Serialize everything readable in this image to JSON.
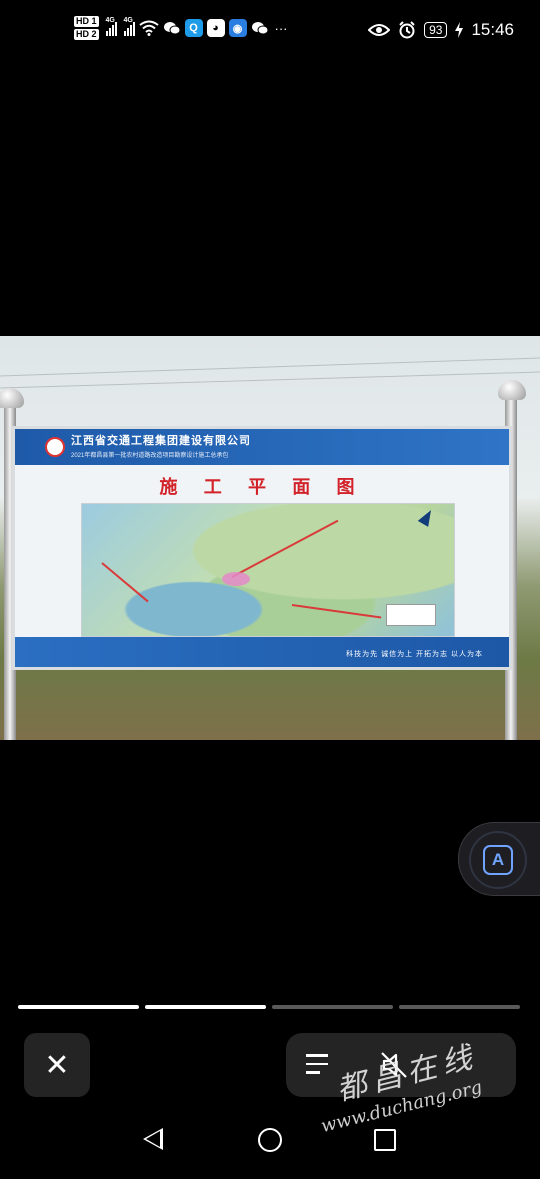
{
  "status_bar": {
    "hd_labels": [
      "HD 1",
      "HD 2"
    ],
    "network_labels": [
      "4G",
      "4G"
    ],
    "notification_icons": [
      "wifi-icon",
      "wechat-icon",
      "search-app-icon",
      "qq-icon",
      "bulb-app-icon",
      "wechat-icon"
    ],
    "more": "···",
    "battery": "93",
    "time": "15:46"
  },
  "photo": {
    "sign": {
      "company": "江西省交通工程集团建设有限公司",
      "project": "2021年都昌县第一批农村道路改造项目勘察设计施工总承包",
      "title": "施 工 平 面 图",
      "slogan": "科技为先  诚信为上  开拓为志  以人为本"
    }
  },
  "overlay": {
    "ocr_button_label": "A"
  },
  "progress": {
    "segments": 4,
    "active_index": 1
  },
  "controls": {
    "close_label": "✕"
  },
  "watermark": {
    "chinese": "都昌在线",
    "url": "www.duchang.org"
  },
  "colors": {
    "accent_blue": "#6fa3ff",
    "sign_blue": "#1e5aa8",
    "sign_title_red": "#d2232a"
  }
}
